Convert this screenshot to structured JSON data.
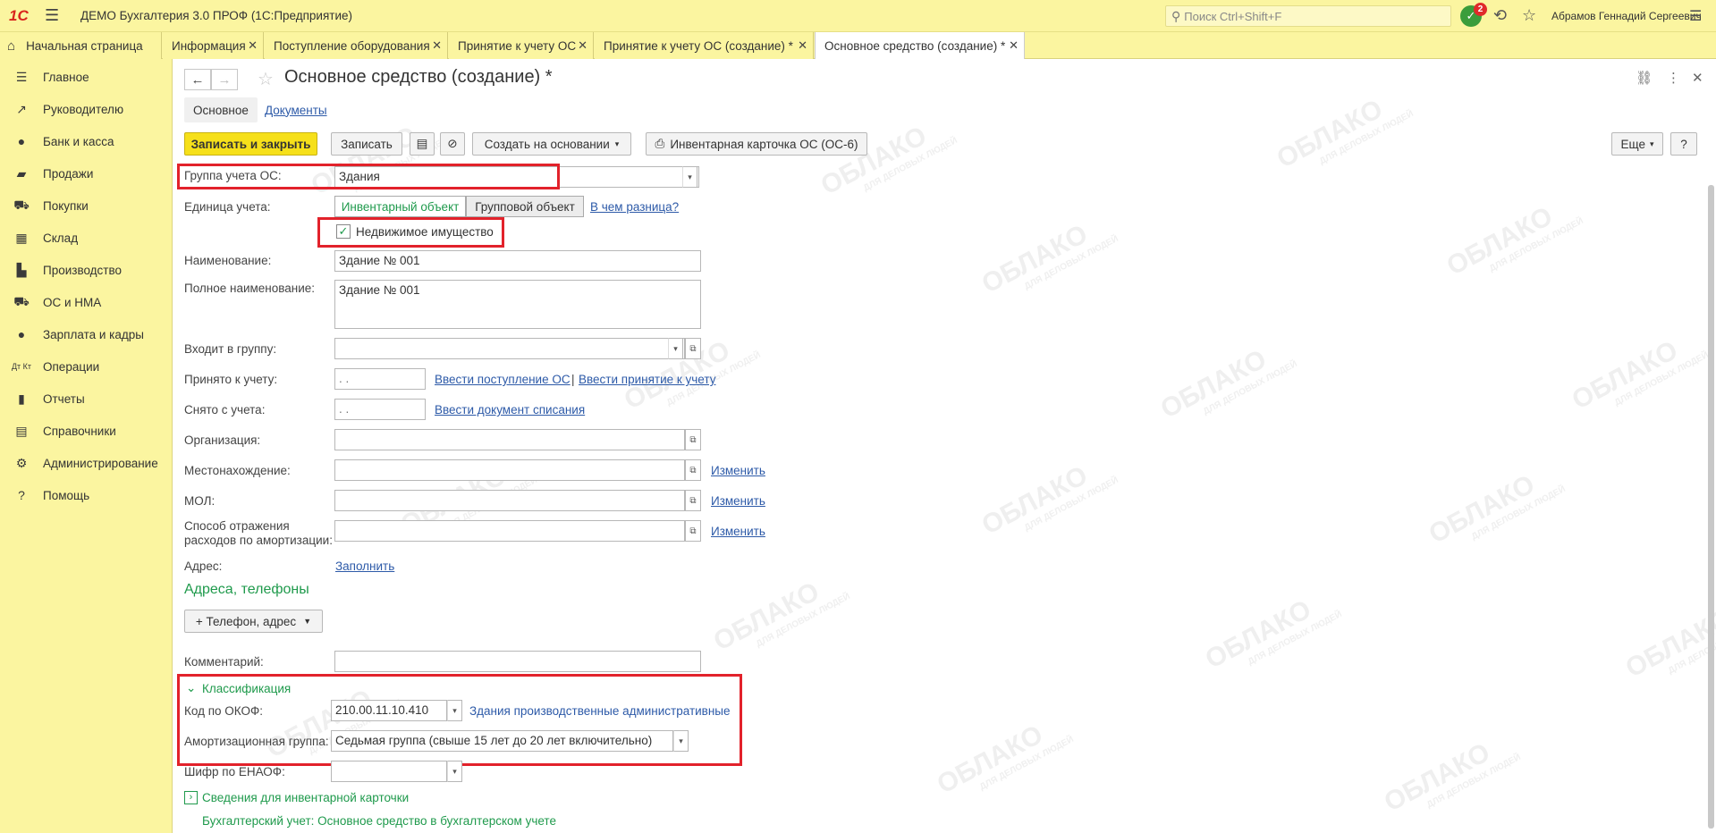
{
  "app": {
    "logo": "1С",
    "title": "ДЕМО Бухгалтерия 3.0 ПРОФ  (1С:Предприятие)",
    "search_placeholder": "Поиск Ctrl+Shift+F",
    "notifications_count": "2",
    "user": "Абрамов Геннадий Сергеевич"
  },
  "tabs": [
    {
      "label": "Начальная страница"
    },
    {
      "label": "Информация"
    },
    {
      "label": "Поступление оборудования"
    },
    {
      "label": "Принятие к учету ОС"
    },
    {
      "label": "Принятие к учету ОС (создание) *"
    },
    {
      "label": "Основное средство (создание) *"
    }
  ],
  "sidebar": {
    "items": [
      {
        "label": "Главное",
        "icon": "menu-icon"
      },
      {
        "label": "Руководителю",
        "icon": "trend-icon"
      },
      {
        "label": "Банк и касса",
        "icon": "coin-icon"
      },
      {
        "label": "Продажи",
        "icon": "bag-icon"
      },
      {
        "label": "Покупки",
        "icon": "cart-icon"
      },
      {
        "label": "Склад",
        "icon": "grid-icon"
      },
      {
        "label": "Производство",
        "icon": "factory-icon"
      },
      {
        "label": "ОС и НМА",
        "icon": "truck-icon"
      },
      {
        "label": "Зарплата и кадры",
        "icon": "person-icon"
      },
      {
        "label": "Операции",
        "icon": "dt-kt-icon"
      },
      {
        "label": "Отчеты",
        "icon": "bar-chart-icon"
      },
      {
        "label": "Справочники",
        "icon": "book-icon"
      },
      {
        "label": "Администрирование",
        "icon": "gear-icon"
      },
      {
        "label": "Помощь",
        "icon": "question-icon"
      }
    ]
  },
  "form": {
    "title": "Основное средство (создание) *",
    "subtabs": {
      "main": "Основное",
      "docs": "Документы"
    },
    "toolbar": {
      "save_close": "Записать и закрыть",
      "save": "Записать",
      "create_based": "Создать на основании",
      "inventory_card": "Инвентарная карточка ОС (ОС-6)",
      "more": "Еще",
      "help": "?"
    },
    "fields": {
      "group_label": "Группа учета ОС:",
      "group_value": "Здания",
      "unit_label": "Единица учета:",
      "unit_inventory": "Инвентарный объект",
      "unit_group": "Групповой объект",
      "unit_diff_link": "В чем разница?",
      "realty_label": "Недвижимое имущество",
      "name_label": "Наименование:",
      "name_value": "Здание № 001",
      "fullname_label": "Полное наименование:",
      "fullname_value": "Здание № 001",
      "parent_label": "Входит в группу:",
      "accepted_label": "Принято к учету:",
      "accepted_value": " .  .",
      "accepted_link1": "Ввести поступление ОС",
      "accepted_sep": "|",
      "accepted_link2": "Ввести принятие к учету",
      "removed_label": "Снято с учета:",
      "removed_value": " .  .",
      "removed_link": "Ввести документ списания",
      "org_label": "Организация:",
      "location_label": "Местонахождение:",
      "location_link": "Изменить",
      "mol_label": "МОЛ:",
      "mol_link": "Изменить",
      "amort_label_1": "Способ отражения",
      "amort_label_2": "расходов по амортизации:",
      "amort_link": "Изменить",
      "address_label": "Адрес:",
      "address_link": "Заполнить",
      "contacts_title": "Адреса, телефоны",
      "contacts_button": "+ Телефон, адрес",
      "comment_label": "Комментарий:"
    },
    "classification": {
      "title": "Классификация",
      "okof_label": "Код по ОКОФ:",
      "okof_value": "210.00.11.10.410",
      "okof_desc": "Здания производственные административные",
      "amort_group_label": "Амортизационная группа:",
      "amort_group_value": "Седьмая группа (свыше 15 лет до 20 лет включительно)",
      "enaof_label": "Шифр по ЕНАОФ:"
    },
    "inventory_section": "Сведения для инвентарной карточки",
    "accounting_link": "Бухгалтерский учет: Основное средство в бухгалтерском учете"
  },
  "watermark": {
    "text": "ОБЛАКО",
    "subtext": "ДЛЯ ДЕЛОВЫХ ЛЮДЕЙ"
  },
  "colors": {
    "accent_yellow": "#f6e01a",
    "panel_yellow": "#fbf5a0",
    "highlight_red": "#e2222b",
    "green": "#1f9a4c",
    "link_blue": "#2d5aa8"
  }
}
